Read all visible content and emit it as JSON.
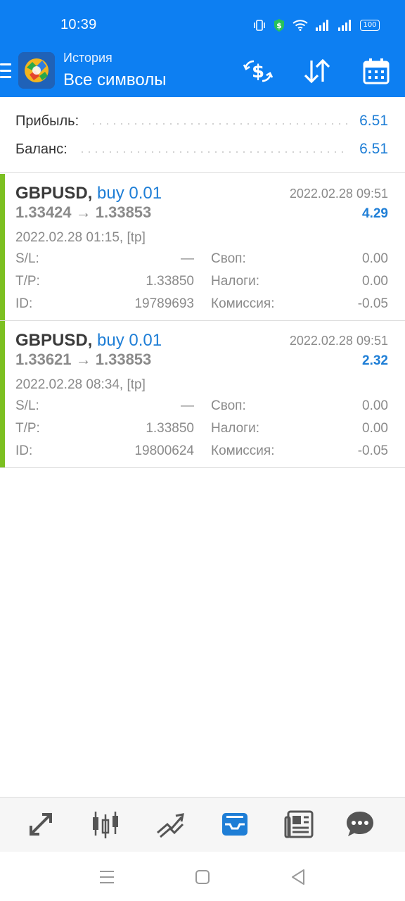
{
  "status_bar": {
    "time": "10:39",
    "battery": "100"
  },
  "header": {
    "subtitle": "История",
    "title": "Все символы",
    "icons": [
      "menu-icon",
      "app-logo",
      "currency-exchange-icon",
      "sort-icon",
      "calendar-icon"
    ]
  },
  "summary": {
    "profit_label": "Прибыль:",
    "profit_value": "6.51",
    "balance_label": "Баланс:",
    "balance_value": "6.51"
  },
  "deals": [
    {
      "symbol": "GBPUSD,",
      "type": "buy 0.01",
      "close_time": "2022.02.28 09:51",
      "prices": "1.33424 → 1.33853",
      "profit": "4.29",
      "open_info": "2022.02.28 01:15, [tp]",
      "sl_label": "S/L:",
      "sl_value": "—",
      "swap_label": "Своп:",
      "swap_value": "0.00",
      "tp_label": "T/P:",
      "tp_value": "1.33850",
      "taxes_label": "Налоги:",
      "taxes_value": "0.00",
      "id_label": "ID:",
      "id_value": "19789693",
      "commission_label": "Комиссия:",
      "commission_value": "-0.05"
    },
    {
      "symbol": "GBPUSD,",
      "type": "buy 0.01",
      "close_time": "2022.02.28 09:51",
      "prices": "1.33621 → 1.33853",
      "profit": "2.32",
      "open_info": "2022.02.28 08:34, [tp]",
      "sl_label": "S/L:",
      "sl_value": "—",
      "swap_label": "Своп:",
      "swap_value": "0.00",
      "tp_label": "T/P:",
      "tp_value": "1.33850",
      "taxes_label": "Налоги:",
      "taxes_value": "0.00",
      "id_label": "ID:",
      "id_value": "19800624",
      "commission_label": "Комиссия:",
      "commission_value": "-0.05"
    }
  ],
  "bottom_nav": {
    "items": [
      "quotes-icon",
      "chart-icon",
      "trade-icon",
      "history-icon",
      "news-icon",
      "chat-icon"
    ],
    "active": "history-icon"
  },
  "colors": {
    "primary": "#0d7ff2",
    "accent_text": "#1e7ed6",
    "buy_bar": "#7cc021",
    "muted_text": "#8a8a8a"
  }
}
